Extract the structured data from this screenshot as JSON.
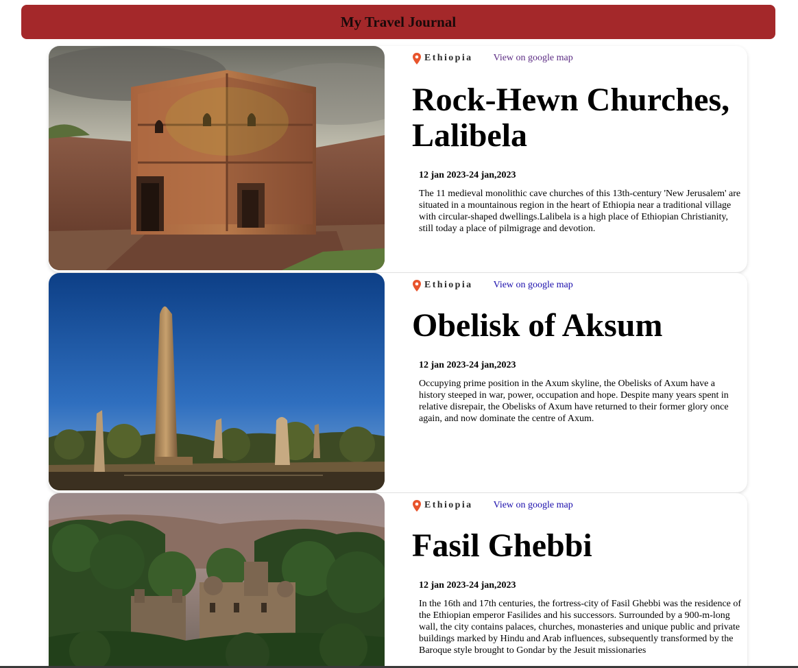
{
  "header": {
    "title": "My Travel Journal"
  },
  "colors": {
    "header_bg": "#a4282a",
    "pin": "#e8542c",
    "link": "#1a0dab"
  },
  "entries": [
    {
      "country": "Ethiopia",
      "map_link": "View on google map",
      "title": "Rock-Hewn Churches, Lalibela",
      "dates": "12 jan 2023-24 jan,2023",
      "description": "The 11 medieval monolithic cave churches of this 13th-century 'New Jerusalem' are situated in a mountainous region in the heart of Ethiopia near a traditional village with circular-shaped dwellings.Lalibela is a high place of Ethiopian Christianity, still today a place of pilmigrage and devotion.",
      "image": "rock-hewn church photo"
    },
    {
      "country": "Ethiopia",
      "map_link": "View on google map",
      "title": "Obelisk of Aksum",
      "dates": "12 jan 2023-24 jan,2023",
      "description": "Occupying prime position in the Axum skyline, the Obelisks of Axum have a history steeped in war, power, occupation and hope. Despite many years spent in relative disrepair, the Obelisks of Axum have returned to their former glory once again, and now dominate the centre of Axum.",
      "image": "obelisk photo"
    },
    {
      "country": "Ethiopia",
      "map_link": "View on google map",
      "title": "Fasil Ghebbi",
      "dates": "12 jan 2023-24 jan,2023",
      "description": "In the 16th and 17th centuries, the fortress-city of Fasil Ghebbi was the residence of the Ethiopian emperor Fasilides and his successors. Surrounded by a 900-m-long wall, the city contains palaces, churches, monasteries and unique public and private buildings marked by Hindu and Arab influences, subsequently transformed by the Baroque style brought to Gondar by the Jesuit missionaries",
      "image": "castle photo"
    }
  ]
}
